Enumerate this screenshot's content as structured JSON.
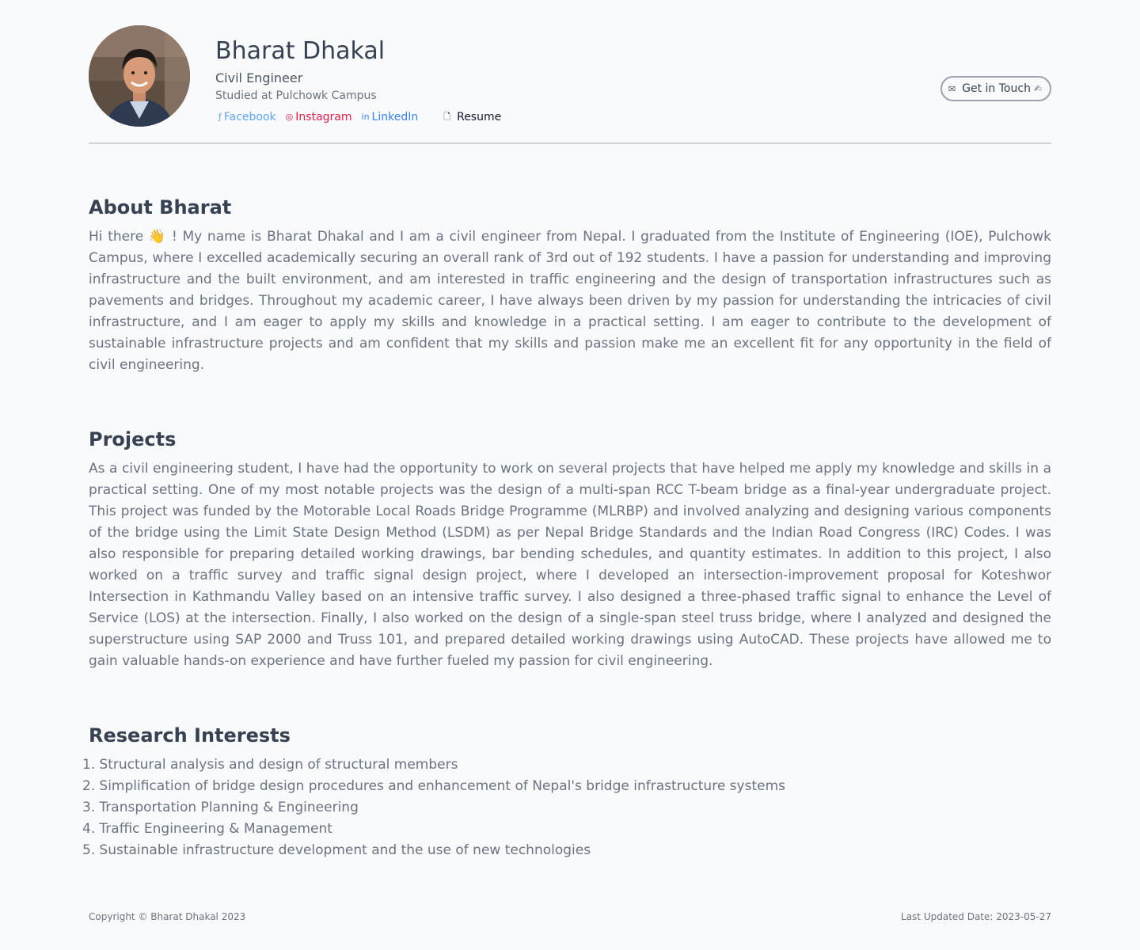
{
  "profile": {
    "name": "Bharat Dhakal",
    "role": "Civil Engineer",
    "studied": "Studied at Pulchowk Campus",
    "avatar_icon": "profile-photo"
  },
  "links": {
    "facebook": {
      "icon": "facebook-icon",
      "glyph": "ƒ",
      "label": "Facebook"
    },
    "instagram": {
      "icon": "instagram-icon",
      "glyph": "◎",
      "label": "Instagram"
    },
    "linkedin": {
      "icon": "linkedin-icon",
      "glyph": "in",
      "label": "LinkedIn"
    },
    "resume": {
      "icon": "file-icon",
      "glyph": "🗋",
      "label": "Resume"
    }
  },
  "contact_button": {
    "icon": "mail-icon",
    "glyph": "✉",
    "label": "Get in Touch",
    "wave": "✍"
  },
  "about": {
    "title": "About Bharat",
    "text": "Hi there 👋 ! My name is Bharat Dhakal and I am a civil engineer from Nepal. I graduated from the Institute of Engineering (IOE), Pulchowk Campus, where I excelled academically securing an overall rank of 3rd out of 192 students. I have a passion for understanding and improving infrastructure and the built environment, and am interested in traffic engineering and the design of transportation infrastructures such as pavements and bridges. Throughout my academic career, I have always been driven by my passion for understanding the intricacies of civil infrastructure, and I am eager to apply my skills and knowledge in a practical setting. I am eager to contribute to the development of sustainable infrastructure projects and am confident that my skills and passion make me an excellent fit for any opportunity in the field of civil engineering."
  },
  "projects": {
    "title": "Projects",
    "text": "As a civil engineering student, I have had the opportunity to work on several projects that have helped me apply my knowledge and skills in a practical setting. One of my most notable projects was the design of a multi-span RCC T-beam bridge as a final-year undergraduate project. This project was funded by the Motorable Local Roads Bridge Programme (MLRBP) and involved analyzing and designing various components of the bridge using the Limit State Design Method (LSDM) as per Nepal Bridge Standards and the Indian Road Congress (IRC) Codes. I was also responsible for preparing detailed working drawings, bar bending schedules, and quantity estimates. In addition to this project, I also worked on a traffic survey and traffic signal design project, where I developed an intersection-improvement proposal for Koteshwor Intersection in Kathmandu Valley based on an intensive traffic survey. I also designed a three-phased traffic signal to enhance the Level of Service (LOS) at the intersection. Finally, I also worked on the design of a single-span steel truss bridge, where I analyzed and designed the superstructure using SAP 2000 and Truss 101, and prepared detailed working drawings using AutoCAD. These projects have allowed me to gain valuable hands-on experience and have further fueled my passion for civil engineering."
  },
  "research": {
    "title": "Research Interests",
    "items": [
      {
        "num": "1.",
        "text": "Structural analysis and design of structural members"
      },
      {
        "num": "2.",
        "text": "Simplification of bridge design procedures and enhancement of Nepal's bridge infrastructure systems"
      },
      {
        "num": "3.",
        "text": "Transportation Planning & Engineering"
      },
      {
        "num": "4.",
        "text": "Traffic Engineering & Management"
      },
      {
        "num": "5.",
        "text": "Sustainable infrastructure development and the use of new technologies"
      }
    ]
  },
  "footer": {
    "copyright": "Copyright © Bharat Dhakal 2023",
    "updated": "Last Updated Date: 2023-05-27"
  }
}
